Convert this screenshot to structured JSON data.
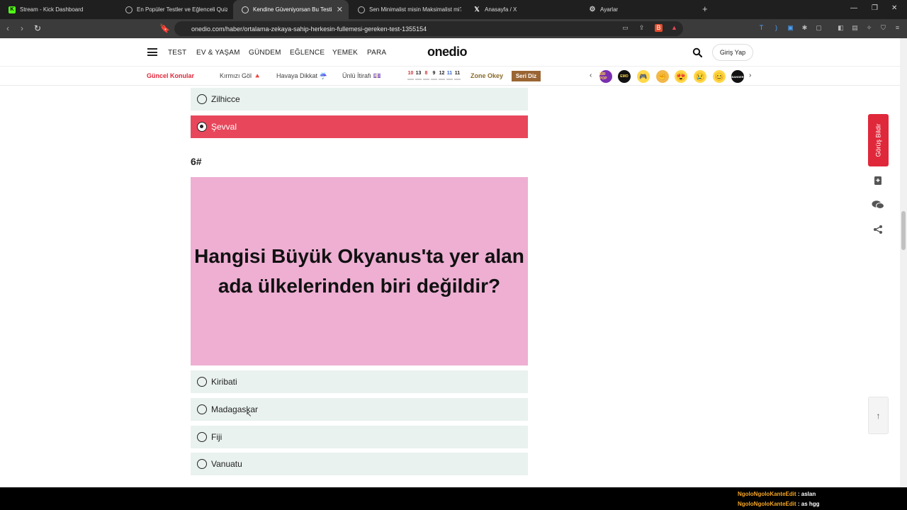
{
  "tabs": [
    {
      "title": "Stream - Kick Dashboard",
      "icon": "kick-icon",
      "color": "#53fc18",
      "active": false
    },
    {
      "title": "En Popüler Testler ve Eğlenceli Quizler",
      "icon": "onedio-icon",
      "color": "#222222",
      "active": false
    },
    {
      "title": "Kendine Güveniyorsan Bu Testi Ku",
      "icon": "onedio-icon",
      "color": "#222222",
      "active": true
    },
    {
      "title": "Sen Minimalist misin Maksimalist mi?",
      "icon": "onedio-icon",
      "color": "#222222",
      "active": false
    },
    {
      "title": "Anasayfa / X",
      "icon": "x-icon",
      "color": "#ffffff",
      "active": false
    },
    {
      "title": "Ayarlar",
      "icon": "gear-icon",
      "color": "#cccccc",
      "active": false
    }
  ],
  "address": {
    "url": "onedio.com/haber/ortalama-zekaya-sahip-herkesin-fullemesi-gereken-test-1355154"
  },
  "nav": {
    "links": [
      "TEST",
      "EV & YAŞAM",
      "GÜNDEM",
      "EĞLENCE",
      "YEMEK",
      "PARA"
    ],
    "logo": "onedio",
    "login": "Giriş Yap"
  },
  "subnav": {
    "hot_label": "Güncel Konular",
    "links": [
      "Kırmızı Göl 🔺",
      "Havaya Dikkat ☔",
      "Ünlü İtirafı 💷"
    ],
    "number_game": [
      "10",
      "13",
      "8",
      "9",
      "12",
      "11",
      "11"
    ],
    "zone_label": "Zone Okey",
    "series_label": "Seri Diz",
    "emoji_badges": [
      "BİR POP",
      "EMO",
      "🎮",
      "✊",
      "😍",
      "😢",
      "😊",
      "BANGER"
    ],
    "accent": "#e0283b"
  },
  "quiz": {
    "prev_options": [
      {
        "label": "Zilhicce",
        "selected": false
      },
      {
        "label": "Şevval",
        "selected": true
      }
    ],
    "question_number": "6#",
    "question_text": "Hangisi Büyük Okyanus'ta yer alan ada ülkelerinden biri değildir?",
    "question_bg": "#eeafd3",
    "options": [
      {
        "label": "Kiribati"
      },
      {
        "label": "Madagaskar"
      },
      {
        "label": "Fiji"
      },
      {
        "label": "Vanuatu"
      }
    ],
    "selected_color": "#e8475b",
    "option_bg": "#e9f2ee"
  },
  "sidebar": {
    "feedback_label": "Görüş Bildir",
    "icons": [
      "bookmark-icon",
      "comments-icon",
      "share-icon"
    ],
    "to_top_icon": "arrow-up-icon"
  },
  "stream_chat": [
    {
      "user": "NgoloNgoloKanteEdit",
      "message": ": aslan"
    },
    {
      "user": "NgoloNgoloKanteEdit",
      "message": ": as hgg"
    }
  ]
}
